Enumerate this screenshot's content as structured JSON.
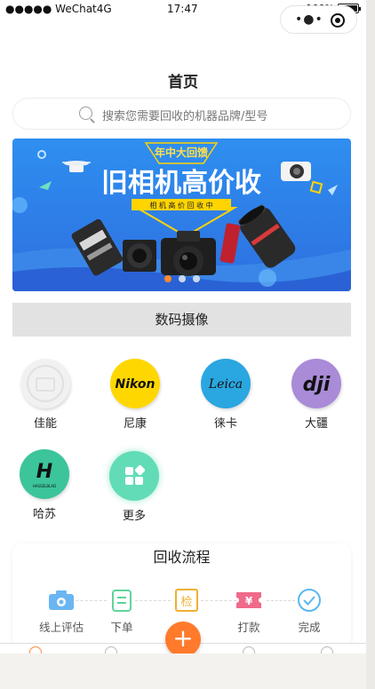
{
  "status_bar": {
    "carrier": "●●●●● WeChat4G",
    "time": "17:47",
    "battery": "100%",
    "battery_level": 1.0
  },
  "capsule": {
    "menu_icon": "more-dots-icon",
    "close_icon": "target-icon"
  },
  "header": {
    "title": "首页"
  },
  "search": {
    "placeholder": "搜索您需要回收的机器品牌/型号",
    "icon": "search-icon"
  },
  "banner": {
    "ribbon": "年中大回馈",
    "headline": "旧相机高价收",
    "tagline": "相 机 高 价 回 收 中",
    "indicator_count": 3,
    "active_indicator": 0
  },
  "section": {
    "title": "数码摄像"
  },
  "brands": [
    {
      "name": "佳能",
      "logo_text": "",
      "logo_color": "#f2f2f2"
    },
    {
      "name": "尼康",
      "logo_text": "Nikon",
      "logo_color": "#ffd700"
    },
    {
      "name": "徕卡",
      "logo_text": "Leica",
      "logo_color": "#2aa6e0"
    },
    {
      "name": "大疆",
      "logo_text": "dji",
      "logo_color": "#a98bd8"
    },
    {
      "name": "哈苏",
      "logo_text": "H",
      "logo_sub": "HASSELBLAD",
      "logo_color": "#3cc49b"
    },
    {
      "name": "更多",
      "logo_text": "",
      "logo_color": "#62dcb6"
    }
  ],
  "flow": {
    "title": "回收流程",
    "steps": [
      {
        "label": "线上评估",
        "icon": "camera-icon",
        "color": "#6ab6f2"
      },
      {
        "label": "下单",
        "icon": "clipboard-icon",
        "color": "#5fd49a"
      },
      {
        "label": "",
        "icon": "inspect-icon",
        "glyph": "检",
        "color": "#f0b030"
      },
      {
        "label": "打款",
        "icon": "payment-icon",
        "glyph": "¥",
        "color": "#f06a8a"
      },
      {
        "label": "完成",
        "icon": "check-circle-icon",
        "color": "#5ab8f0"
      }
    ]
  },
  "tabbar": {
    "fab": "+"
  }
}
